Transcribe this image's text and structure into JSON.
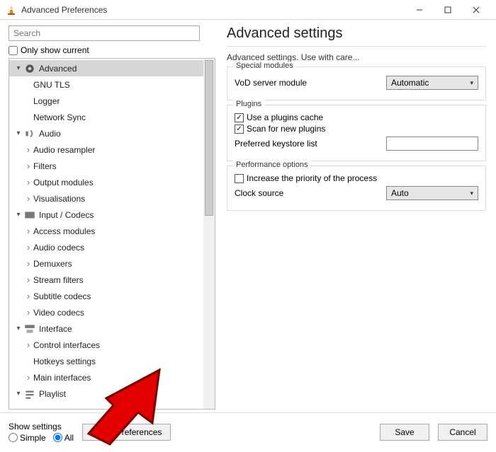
{
  "titlebar": {
    "title": "Advanced Preferences"
  },
  "search": {
    "placeholder": "Search"
  },
  "only_show_current": "Only show current",
  "tree": {
    "advanced": "Advanced",
    "advanced_children": [
      "GNU TLS",
      "Logger",
      "Network Sync"
    ],
    "audio": "Audio",
    "audio_children": [
      "Audio resampler",
      "Filters",
      "Output modules",
      "Visualisations"
    ],
    "input": "Input / Codecs",
    "input_children": [
      "Access modules",
      "Audio codecs",
      "Demuxers",
      "Stream filters",
      "Subtitle codecs",
      "Video codecs"
    ],
    "interface": "Interface",
    "interface_children": [
      "Control interfaces",
      "Hotkeys settings",
      "Main interfaces"
    ],
    "playlist": "Playlist"
  },
  "right": {
    "heading": "Advanced settings",
    "subtext": "Advanced settings. Use with care...",
    "special_modules": {
      "legend": "Special modules",
      "vod_label": "VoD server module",
      "vod_value": "Automatic"
    },
    "plugins": {
      "legend": "Plugins",
      "use_cache": "Use a plugins cache",
      "scan_new": "Scan for new plugins",
      "keystore_label": "Preferred keystore list",
      "keystore_value": ""
    },
    "perf": {
      "legend": "Performance options",
      "priority": "Increase the priority of the process",
      "clock_label": "Clock source",
      "clock_value": "Auto"
    }
  },
  "footer": {
    "show_settings": "Show settings",
    "simple": "Simple",
    "all": "All",
    "reset": "Reset Preferences",
    "save": "Save",
    "cancel": "Cancel"
  }
}
